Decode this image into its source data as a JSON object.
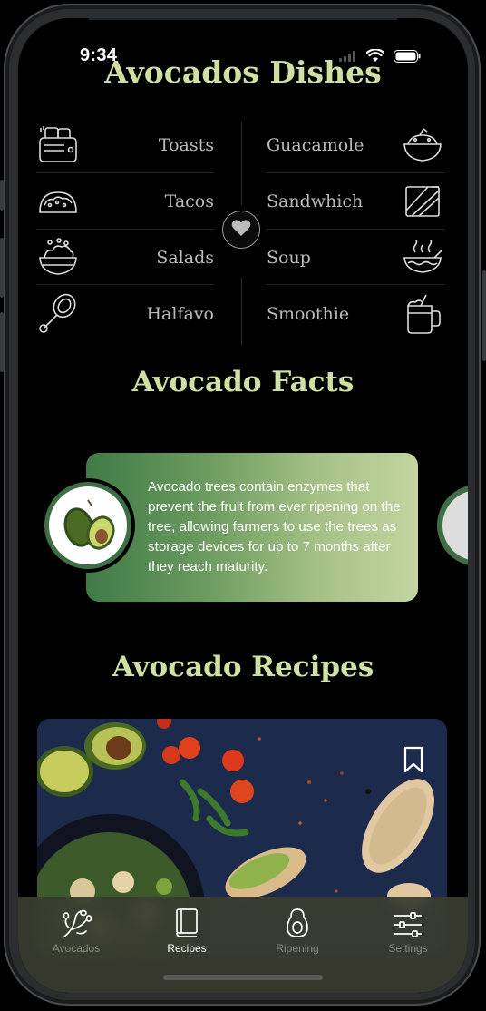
{
  "status_bar": {
    "time": "9:34"
  },
  "dishes": {
    "title": "Avocados Dishes",
    "left": [
      {
        "label": "Toasts",
        "icon": "toaster-icon"
      },
      {
        "label": "Tacos",
        "icon": "taco-icon"
      },
      {
        "label": "Salads",
        "icon": "salad-bowl-icon"
      },
      {
        "label": "Halfavo",
        "icon": "half-avocado-icon"
      }
    ],
    "right": [
      {
        "label": "Guacamole",
        "icon": "guacamole-bowl-icon"
      },
      {
        "label": "Sandwhich",
        "icon": "sandwich-icon"
      },
      {
        "label": "Soup",
        "icon": "soup-bowl-icon"
      },
      {
        "label": "Smoothie",
        "icon": "smoothie-jar-icon"
      }
    ]
  },
  "facts": {
    "title": "Avocado Facts",
    "text": "Avocado trees contain enzymes that prevent the fruit from ever ripening on the tree, allowing farmers to use the trees as storage devices for up to 7 months after they reach maturity."
  },
  "recipes": {
    "title": "Avocado Recipes"
  },
  "tabs": [
    {
      "label": "Avocados",
      "icon": "avocado-branch-icon",
      "active": false
    },
    {
      "label": "Recipes",
      "icon": "book-icon",
      "active": true
    },
    {
      "label": "Ripening",
      "icon": "avocado-icon",
      "active": false
    },
    {
      "label": "Settings",
      "icon": "sliders-icon",
      "active": false
    }
  ],
  "colors": {
    "accent_title": "#d0e0a3",
    "card_gradient_start": "#3f7a46",
    "card_gradient_end": "#c4d5a1",
    "tab_active": "#ffffff",
    "tab_inactive": "#8c8f85"
  }
}
